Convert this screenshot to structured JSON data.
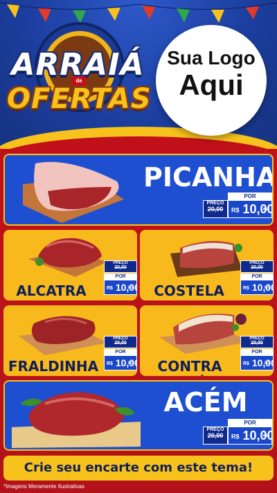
{
  "header": {
    "logo_line1": "ARRAIÁ",
    "logo_de": "de",
    "logo_line2": "OFERTAS",
    "placeholder_logo_line1": "Sua Logo",
    "placeholder_logo_line2": "Aqui"
  },
  "tag_labels": {
    "preco": "PREÇO",
    "por": "POR",
    "currency": "R$",
    "unit": "KG"
  },
  "products": [
    {
      "name": "PICANHA",
      "old_price": "20,00",
      "price": "10,00",
      "size": "large"
    },
    {
      "name": "ALCATRA",
      "old_price": "20,00",
      "price": "10,00",
      "size": "small"
    },
    {
      "name": "COSTELA",
      "old_price": "20,00",
      "price": "10,00",
      "size": "small"
    },
    {
      "name": "FRALDINHA",
      "old_price": "20,00",
      "price": "10,00",
      "size": "small"
    },
    {
      "name": "CONTRA FILÉ",
      "old_price": "20,00",
      "price": "10,00",
      "size": "small"
    },
    {
      "name": "ACÉM",
      "old_price": "20,00",
      "price": "10,00",
      "size": "large"
    }
  ],
  "footer": {
    "cta": "Crie seu encarte com este tema!",
    "disclaimer": "*Imagens Meramente Ilustrativas"
  },
  "colors": {
    "blue": "#1f4fd1",
    "yellow": "#f7b91b",
    "red": "#b3121b",
    "navy": "#0f2a8a"
  }
}
